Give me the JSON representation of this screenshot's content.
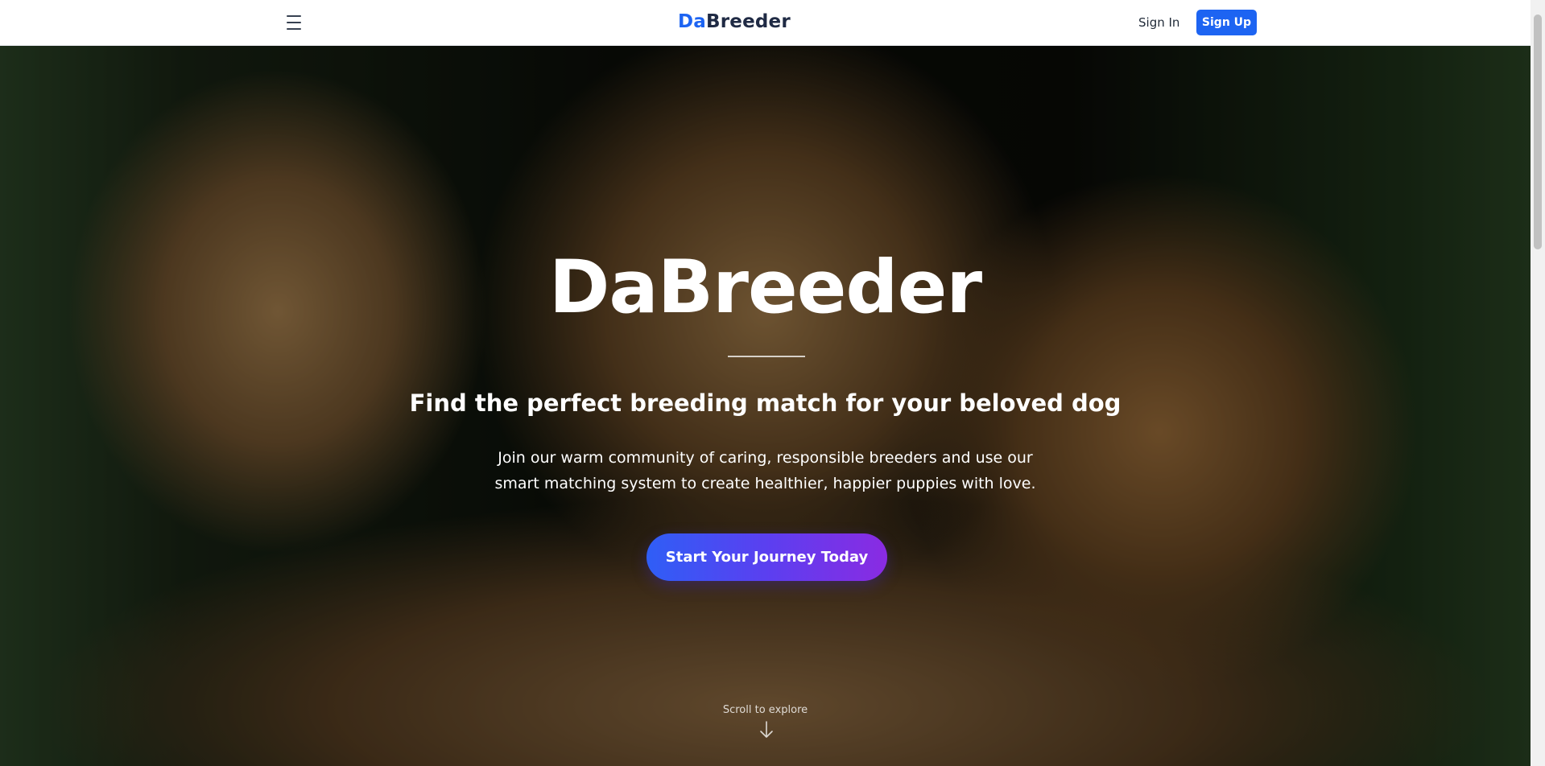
{
  "navbar": {
    "brand_prefix": "Da",
    "brand_suffix": "Breeder",
    "signin_label": "Sign In",
    "signup_label": "Sign Up",
    "menu_icon": "hamburger-icon"
  },
  "hero": {
    "title": "DaBreeder",
    "subtitle": "Find the perfect breeding match for your beloved dog",
    "description_line1": "Join our warm community of caring, responsible breeders and use our",
    "description_line2": "smart matching system to create healthier, happier puppies with love.",
    "cta_label": "Start Your Journey Today",
    "scroll_hint": "Scroll to explore",
    "scroll_icon": "arrow-down-icon"
  },
  "colors": {
    "brand_blue": "#1d64f2",
    "brand_dark": "#1f2a44",
    "cta_gradient_start": "#2f5ef6",
    "cta_gradient_end": "#8a2be2"
  }
}
